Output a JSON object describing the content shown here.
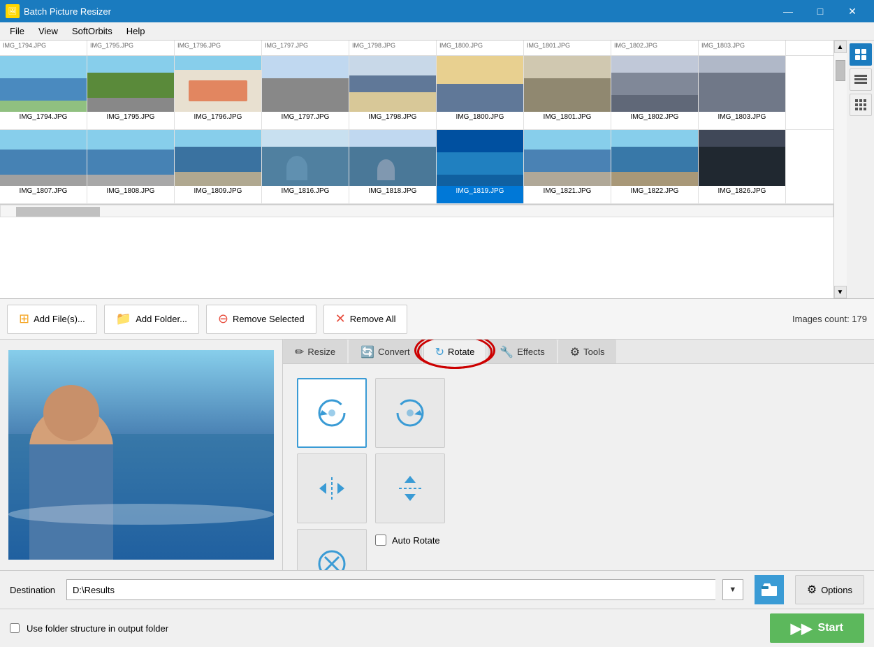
{
  "app": {
    "title": "Batch Picture Resizer",
    "icon": "🖼"
  },
  "window_controls": {
    "minimize": "—",
    "maximize": "□",
    "close": "✕"
  },
  "menubar": {
    "items": [
      "File",
      "View",
      "SoftOrbits",
      "Help"
    ]
  },
  "grid": {
    "row1": {
      "headers": [
        "IMG_1794.JPG",
        "IMG_1795.JPG",
        "IMG_1796.JPG",
        "IMG_1797.JPG",
        "IMG_1798.JPG",
        "IMG_1800.JPG",
        "IMG_1801.JPG",
        "IMG_1802.JPG",
        "IMG_1803.JPG"
      ],
      "thumb_classes": [
        "thumb-blue",
        "thumb-green",
        "thumb-store",
        "thumb-road",
        "thumb-beach",
        "thumb-beach",
        "thumb-orange",
        "thumb-gray",
        "thumb-gray"
      ]
    },
    "row2": {
      "headers": [
        "IMG_1807.JPG",
        "IMG_1808.JPG",
        "IMG_1809.JPG",
        "IMG_1816.JPG",
        "IMG_1818.JPG",
        "IMG_1819.JPG",
        "IMG_1821.JPG",
        "IMG_1822.JPG",
        "IMG_1826.JPG"
      ],
      "thumb_classes": [
        "thumb-sea",
        "thumb-sea",
        "thumb-sea",
        "thumb-person",
        "thumb-person",
        "thumb-person",
        "thumb-sea",
        "thumb-sea",
        "thumb-dark"
      ],
      "selected_index": 5
    }
  },
  "toolbar": {
    "add_files_label": "Add File(s)...",
    "add_folder_label": "Add Folder...",
    "remove_selected_label": "Remove Selected",
    "remove_all_label": "Remove All",
    "images_count_label": "Images count: 179"
  },
  "tabs": {
    "items": [
      {
        "label": "Resize",
        "icon": "✏"
      },
      {
        "label": "Convert",
        "icon": "🔄"
      },
      {
        "label": "Rotate",
        "icon": "↻"
      },
      {
        "label": "Effects",
        "icon": "🔧"
      },
      {
        "label": "Tools",
        "icon": "⚙"
      }
    ],
    "active": 2
  },
  "rotate": {
    "btn_ccw_label": "↺",
    "btn_cw_label": "↻",
    "btn_fliph_label": "↔",
    "btn_flipv_label": "↕",
    "btn_reset_label": "⊗",
    "auto_rotate_label": "Auto Rotate"
  },
  "destination": {
    "label": "Destination",
    "value": "D:\\Results",
    "placeholder": "D:\\Results"
  },
  "options_btn_label": "Options",
  "use_folder_label": "Use folder structure in output folder",
  "start_btn_label": "Start",
  "sidebar_icons": {
    "photo": "🖼",
    "list": "≡",
    "grid": "⊞"
  }
}
